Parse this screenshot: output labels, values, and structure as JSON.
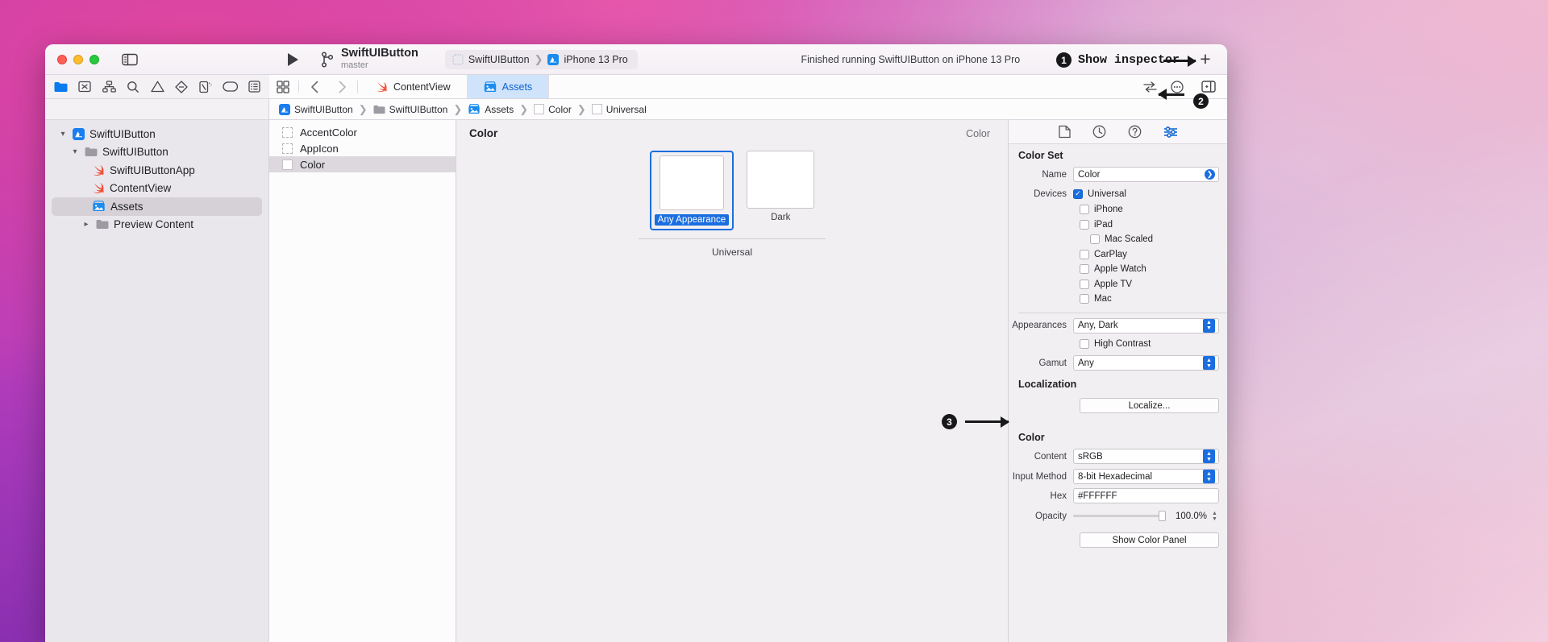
{
  "window": {
    "traffic_lights": [
      "close",
      "minimize",
      "zoom"
    ],
    "project_name": "SwiftUIButton",
    "branch": "master",
    "scheme": "SwiftUIButton",
    "destination": "iPhone 13 Pro",
    "status": "Finished running SwiftUIButton on iPhone 13 Pro",
    "add_label": "+"
  },
  "annotations": [
    {
      "number": "1",
      "text": "Show inspector"
    },
    {
      "number": "2",
      "text": ""
    },
    {
      "number": "3",
      "text": ""
    }
  ],
  "navigator_toolbar_icons": [
    "folder-icon",
    "source-control-icon",
    "hierarchy-icon",
    "search-icon",
    "warning-icon",
    "test-icon",
    "debug-icon",
    "breakpoint-icon",
    "report-icon"
  ],
  "editor": {
    "jump_bar_icons": [
      "grid-icon",
      "back-arrow-icon",
      "forward-arrow-icon"
    ],
    "tabs": [
      {
        "label": "ContentView",
        "icon": "swift-file-icon",
        "active": false
      },
      {
        "label": "Assets",
        "icon": "assets-icon",
        "active": true
      }
    ],
    "right_icons": [
      "adjust-editor-icon",
      "more-options-icon",
      "inspector-toggle-icon"
    ],
    "breadcrumbs": [
      {
        "label": "SwiftUIButton",
        "icon": "app-icon"
      },
      {
        "label": "SwiftUIButton",
        "icon": "folder-icon"
      },
      {
        "label": "Assets",
        "icon": "assets-icon"
      },
      {
        "label": "Color",
        "icon": "color-swatch-icon"
      },
      {
        "label": "Universal",
        "icon": "color-swatch-icon"
      }
    ]
  },
  "navigator": {
    "items": [
      {
        "label": "SwiftUIButton",
        "icon": "app-icon",
        "depth": 0,
        "twisty": "open",
        "selected": false
      },
      {
        "label": "SwiftUIButton",
        "icon": "folder-icon",
        "depth": 1,
        "twisty": "open",
        "selected": false
      },
      {
        "label": "SwiftUIButtonApp",
        "icon": "swift-file-icon",
        "depth": 2,
        "twisty": "none",
        "selected": false
      },
      {
        "label": "ContentView",
        "icon": "swift-file-icon",
        "depth": 2,
        "twisty": "none",
        "selected": false
      },
      {
        "label": "Assets",
        "icon": "assets-icon",
        "depth": 2,
        "twisty": "none",
        "selected": true
      },
      {
        "label": "Preview Content",
        "icon": "folder-icon",
        "depth": 2,
        "twisty": "closed",
        "selected": false
      }
    ]
  },
  "asset_list": {
    "items": [
      {
        "label": "AccentColor",
        "icon": "placeholder-swatch-icon",
        "selected": false
      },
      {
        "label": "AppIcon",
        "icon": "placeholder-swatch-icon",
        "selected": false
      },
      {
        "label": "Color",
        "icon": "color-swatch-icon",
        "selected": true
      }
    ]
  },
  "canvas": {
    "title": "Color",
    "kind": "Color",
    "group_label": "Universal",
    "swatches": [
      {
        "label": "Any Appearance",
        "selected": true,
        "color": "#FFFFFF"
      },
      {
        "label": "Dark",
        "selected": false,
        "color": "#FFFFFF"
      }
    ]
  },
  "inspector": {
    "tabs": [
      "file-inspector-icon",
      "history-inspector-icon",
      "quick-help-icon",
      "attributes-inspector-icon"
    ],
    "active_tab": "attributes-inspector-icon",
    "color_set": {
      "title": "Color Set",
      "name_label": "Name",
      "name_value": "Color",
      "devices_label": "Devices",
      "devices": [
        {
          "label": "Universal",
          "checked": true,
          "indent": false
        },
        {
          "label": "iPhone",
          "checked": false,
          "indent": false
        },
        {
          "label": "iPad",
          "checked": false,
          "indent": false
        },
        {
          "label": "Mac Scaled",
          "checked": false,
          "indent": true
        },
        {
          "label": "CarPlay",
          "checked": false,
          "indent": false
        },
        {
          "label": "Apple Watch",
          "checked": false,
          "indent": false
        },
        {
          "label": "Apple TV",
          "checked": false,
          "indent": false
        },
        {
          "label": "Mac",
          "checked": false,
          "indent": false
        }
      ],
      "appearances_label": "Appearances",
      "appearances_value": "Any, Dark",
      "high_contrast_label": "High Contrast",
      "high_contrast_checked": false,
      "gamut_label": "Gamut",
      "gamut_value": "Any",
      "localization_label": "Localization",
      "localize_button": "Localize..."
    },
    "color": {
      "title": "Color",
      "content_label": "Content",
      "content_value": "sRGB",
      "input_method_label": "Input Method",
      "input_method_value": "8-bit Hexadecimal",
      "hex_label": "Hex",
      "hex_value": "#FFFFFF",
      "opacity_label": "Opacity",
      "opacity_value": "100.0%",
      "show_color_panel_button": "Show Color Panel"
    }
  },
  "colors": {
    "accent": "#1a6ee0",
    "tab_active_bg": "#cfe3fb",
    "tab_active_text": "#0a62d0",
    "swift_orange": "#f05138"
  }
}
